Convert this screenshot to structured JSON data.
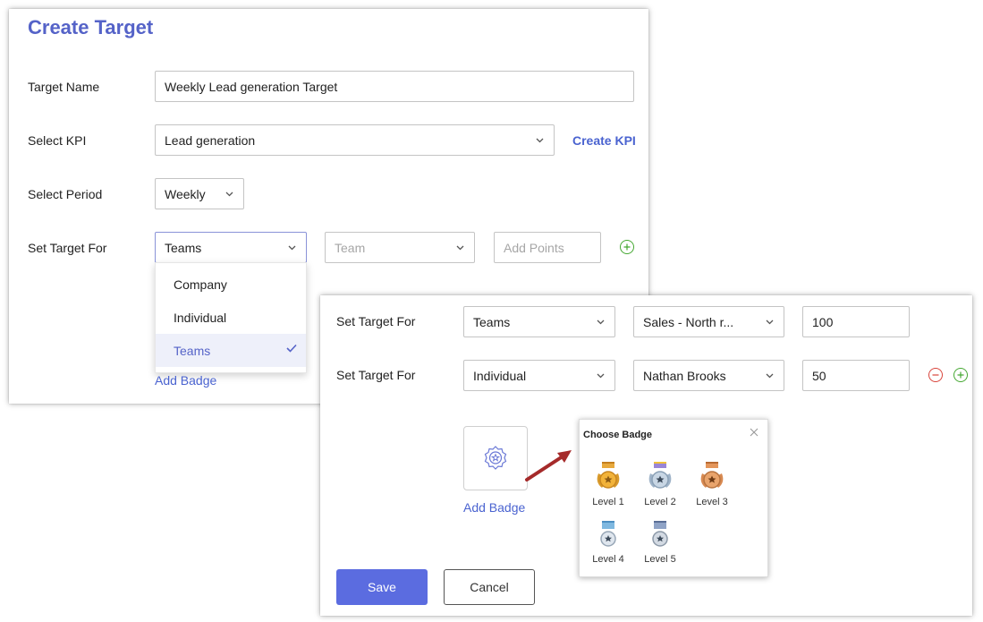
{
  "form": {
    "title": "Create Target",
    "target_name": {
      "label": "Target Name",
      "value": "Weekly Lead generation Target"
    },
    "kpi": {
      "label": "Select KPI",
      "value": "Lead generation",
      "create_link": "Create KPI"
    },
    "period": {
      "label": "Select Period",
      "value": "Weekly"
    },
    "set_target": {
      "label": "Set Target For",
      "value": "Teams",
      "team_placeholder": "Team",
      "points_placeholder": "Add Points"
    },
    "dropdown_options": [
      {
        "label": "Company",
        "selected": false
      },
      {
        "label": "Individual",
        "selected": false
      },
      {
        "label": "Teams",
        "selected": true
      }
    ],
    "add_badge": "Add Badge"
  },
  "detail": {
    "rows": [
      {
        "label": "Set Target For",
        "type": "Teams",
        "member": "Sales - North r...",
        "points": "100"
      },
      {
        "label": "Set Target For",
        "type": "Individual",
        "member": "Nathan Brooks",
        "points": "50"
      }
    ],
    "add_badge": "Add Badge",
    "save": "Save",
    "cancel": "Cancel"
  },
  "badge_popup": {
    "title": "Choose Badge",
    "levels": [
      "Level 1",
      "Level 2",
      "Level 3",
      "Level 4",
      "Level 5"
    ]
  },
  "colors": {
    "accent": "#5563c8",
    "link": "#4a63d0",
    "save_button": "#5b6ce0",
    "add_green": "#45a832",
    "remove_red": "#d9453c",
    "arrow": "#a52a2a"
  }
}
